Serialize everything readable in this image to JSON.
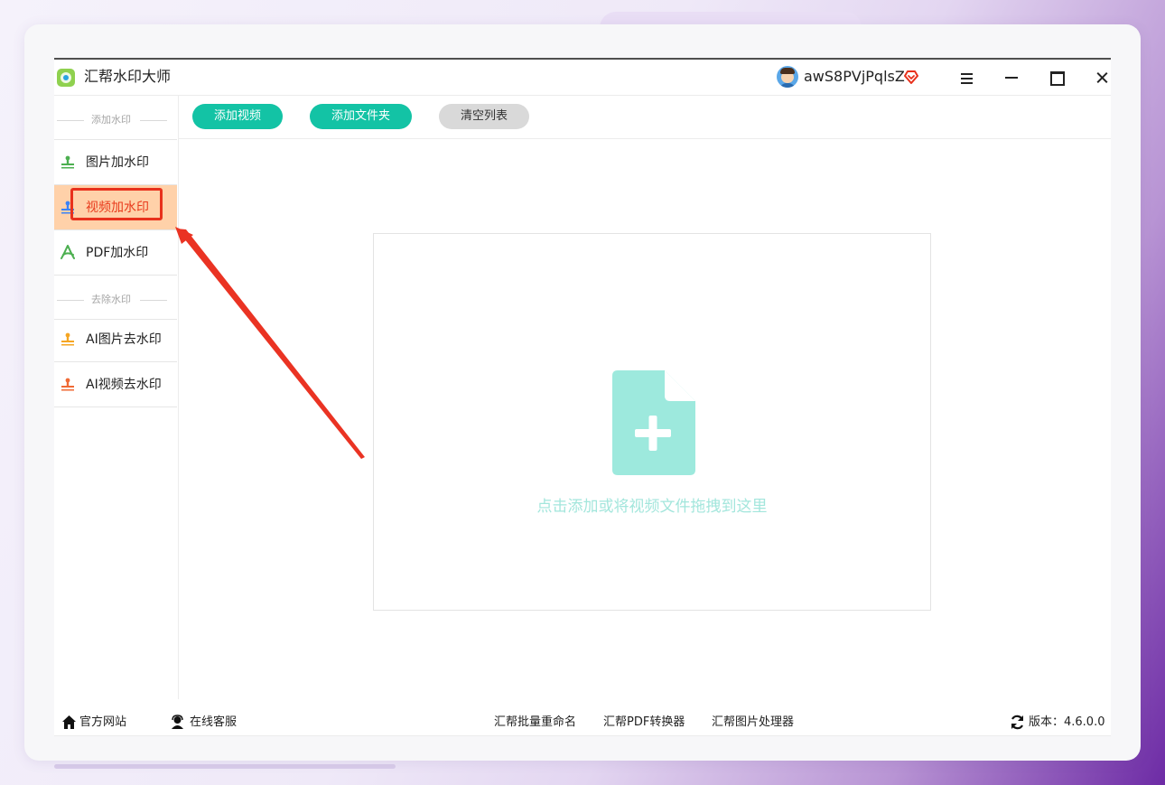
{
  "app": {
    "title": "汇帮水印大师",
    "username": "awS8PVjPqlsZ"
  },
  "sidebar": {
    "sections": [
      {
        "header": "添加水印",
        "items": [
          {
            "label": "图片加水印",
            "icon": "image-watermark-icon",
            "icon_color": "#4caf50",
            "active": false
          },
          {
            "label": "视频加水印",
            "icon": "video-watermark-icon",
            "icon_color": "#3b82f6",
            "active": true
          },
          {
            "label": "PDF加水印",
            "icon": "pdf-icon",
            "icon_color": "#4caf50",
            "active": false
          }
        ]
      },
      {
        "header": "去除水印",
        "items": [
          {
            "label": "AI图片去水印",
            "icon": "ai-image-remove-icon",
            "icon_color": "#f5a623",
            "active": false
          },
          {
            "label": "AI视频去水印",
            "icon": "ai-video-remove-icon",
            "icon_color": "#f06a35",
            "active": false
          }
        ]
      }
    ]
  },
  "toolbar": {
    "add_video": "添加视频",
    "add_folder": "添加文件夹",
    "clear_list": "清空列表"
  },
  "dropzone": {
    "text": "点击添加或将视频文件拖拽到这里"
  },
  "footer": {
    "website": "官方网站",
    "support": "在线客服",
    "links": [
      "汇帮批量重命名",
      "汇帮PDF转换器",
      "汇帮图片处理器"
    ],
    "version": "版本：4.6.0.0"
  },
  "colors": {
    "accent": "#13c3a5",
    "active_bg": "#ffd1a9",
    "active_text": "#e83a1c",
    "highlight": "#e8311c"
  }
}
